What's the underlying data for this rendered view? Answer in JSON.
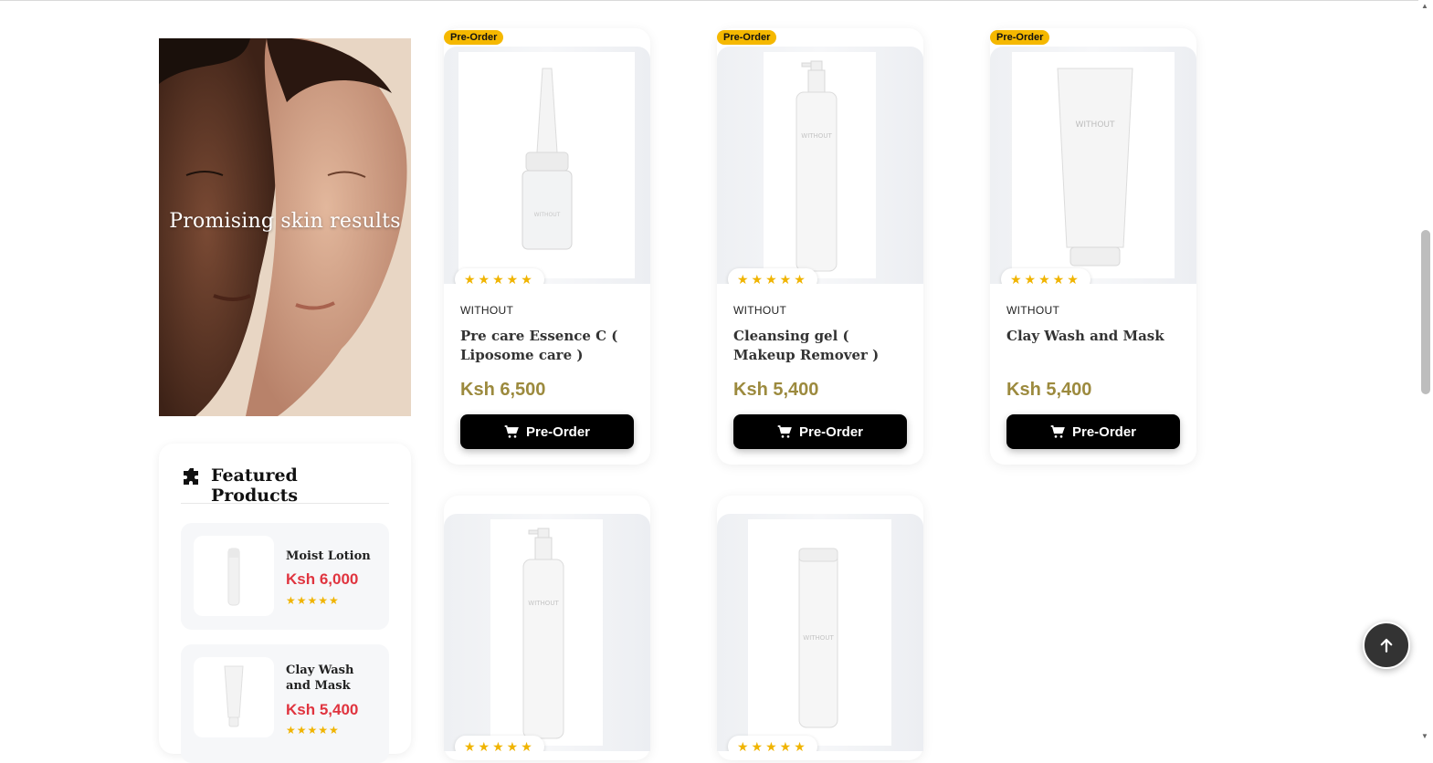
{
  "promo": {
    "text": "Promising skin results"
  },
  "featured": {
    "title": "Featured Products",
    "items": [
      {
        "name": "Moist Lotion",
        "price": "Ksh 6,000",
        "stars": "★★★★★"
      },
      {
        "name": "Clay Wash and Mask",
        "price": "Ksh 5,400",
        "stars": "★★★★★"
      }
    ]
  },
  "products": [
    {
      "badge": "Pre-Order",
      "stars": "★★★★★",
      "brand": "WITHOUT",
      "name": "Pre care Essence C ( Liposome care )",
      "price": "Ksh 6,500",
      "button": "Pre-Order"
    },
    {
      "badge": "Pre-Order",
      "stars": "★★★★★",
      "brand": "WITHOUT",
      "name": "Cleansing gel ( Makeup Remover )",
      "price": "Ksh 5,400",
      "button": "Pre-Order"
    },
    {
      "badge": "Pre-Order",
      "stars": "★★★★★",
      "brand": "WITHOUT",
      "name": "Clay Wash and Mask",
      "price": "Ksh 5,400",
      "button": "Pre-Order"
    },
    {
      "stars": "★★★★★"
    },
    {
      "stars": "★★★★★"
    }
  ],
  "product_labels": {
    "bottle_brand": "WITHOUT"
  },
  "icons": {
    "cart": "cart-icon",
    "featured": "puzzle-icon",
    "scroll_top": "arrow-up-icon"
  },
  "colors": {
    "badge": "#f5b800",
    "price_gold": "#9c8a3e",
    "price_red": "#e0343f",
    "button": "#000000",
    "star": "#f0b400"
  }
}
